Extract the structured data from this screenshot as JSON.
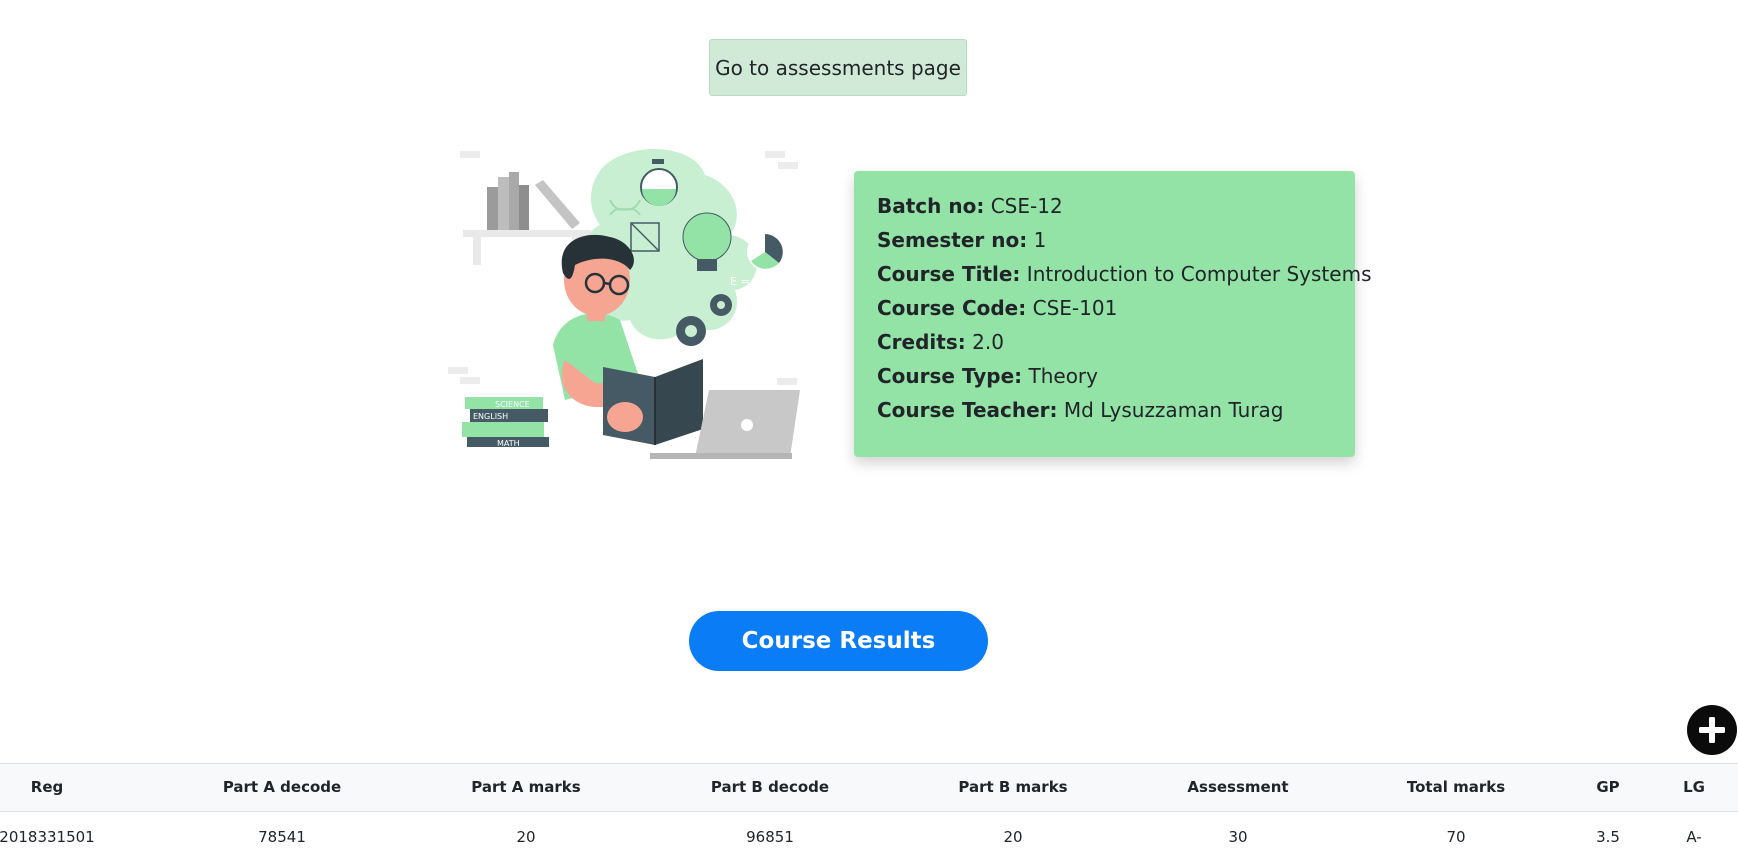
{
  "assessments_button": "Go to assessments page",
  "course_info": {
    "batch_label": "Batch no:",
    "batch_value": "CSE-12",
    "semester_label": "Semester no:",
    "semester_value": "1",
    "title_label": "Course Title:",
    "title_value": "Introduction to Computer Systems",
    "code_label": "Course Code:",
    "code_value": "CSE-101",
    "credits_label": "Credits:",
    "credits_value": "2.0",
    "type_label": "Course Type:",
    "type_value": "Theory",
    "teacher_label": "Course Teacher:",
    "teacher_value": "Md Lysuzzaman Turag"
  },
  "illustration": {
    "book_labels": [
      "SCIENCE",
      "ENGLISH",
      "MATH"
    ],
    "formula": "E = mc²"
  },
  "results_button": "Course Results",
  "add_button_icon": "plus-icon",
  "table": {
    "headers": [
      "Reg",
      "Part A decode",
      "Part A marks",
      "Part B decode",
      "Part B marks",
      "Assessment",
      "Total marks",
      "GP",
      "LG"
    ],
    "rows": [
      [
        "2018331501",
        "78541",
        "20",
        "96851",
        "20",
        "30",
        "70",
        "3.5",
        "A-"
      ]
    ]
  },
  "colors": {
    "card_bg": "#93e3a7",
    "assess_btn_bg": "#d1ead8",
    "results_btn_bg": "#0a7cf6",
    "fab_bg": "#0b0b0b",
    "table_header_bg": "#f8f9fa"
  }
}
